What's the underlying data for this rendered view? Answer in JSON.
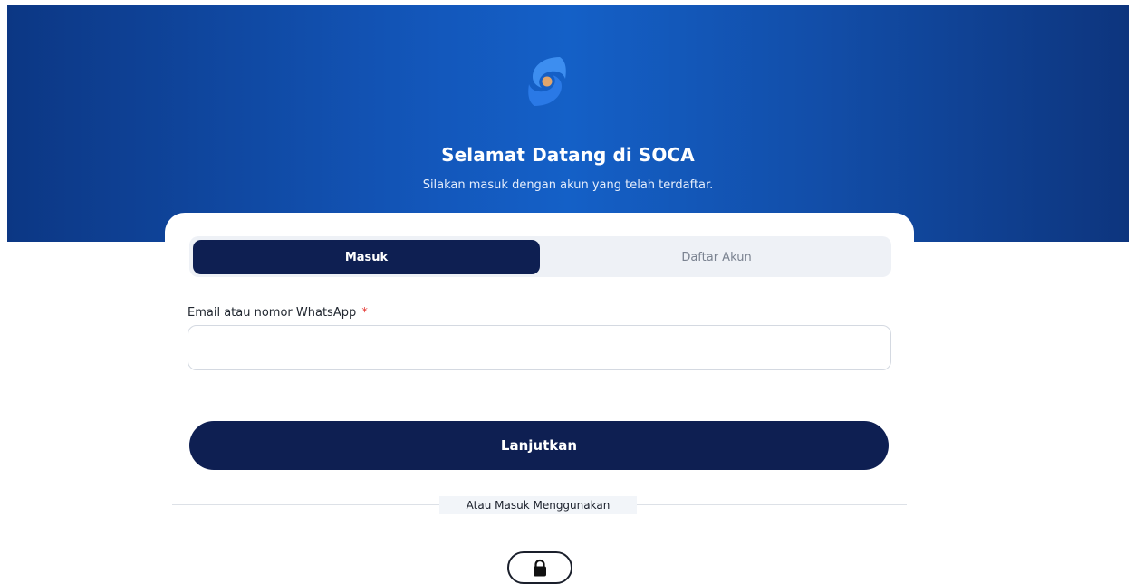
{
  "header": {
    "title": "Selamat Datang di SOCA",
    "subtitle": "Silakan masuk dengan akun yang telah terdaftar.",
    "logo_icon": "soca-logo-icon",
    "gradient_colors": [
      "#0c3784",
      "#1460c7",
      "#0d357e"
    ]
  },
  "tabs": [
    {
      "label": "Masuk",
      "active": true
    },
    {
      "label": "Daftar Akun",
      "active": false
    }
  ],
  "form": {
    "email_label": "Email atau nomor WhatsApp",
    "required_marker": "*",
    "email_value": "",
    "email_placeholder": "",
    "submit_label": "Lanjutkan"
  },
  "alternative": {
    "divider_text": "Atau Masuk Menggunakan",
    "button_icon": "lock-icon"
  },
  "colors": {
    "primary": "#0e1f52",
    "required": "#e53935",
    "tab_track": "#eef1f6"
  }
}
